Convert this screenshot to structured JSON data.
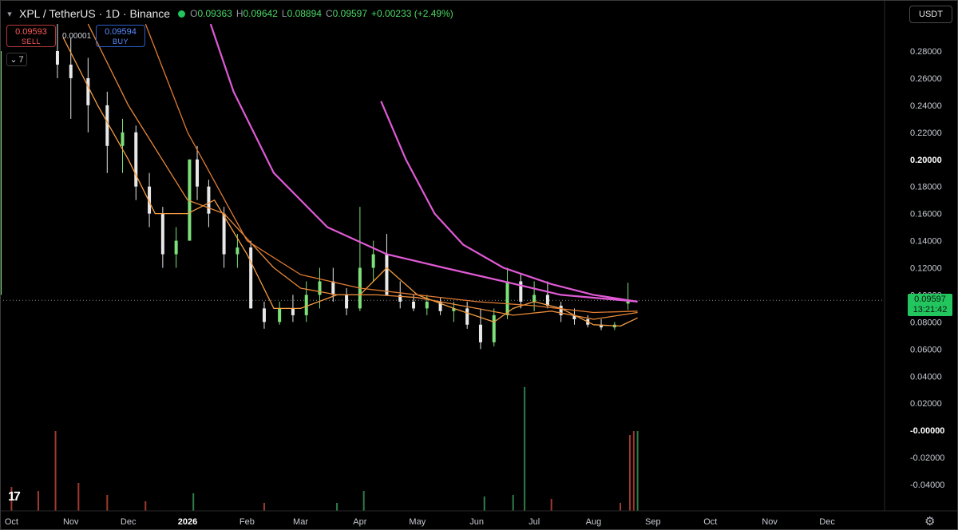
{
  "header": {
    "symbol": "XPL / TetherUS · 1D · Binance",
    "collapse_icon": "chevron-down-icon",
    "status_color": "#22c55e",
    "ohlc": {
      "o_label": "O",
      "o_value": "0.09363",
      "h_label": "H",
      "h_value": "0.09642",
      "l_label": "L",
      "l_value": "0.08894",
      "c_label": "C",
      "c_value": "0.09597",
      "change": "+0.00233 (+2.49%)"
    }
  },
  "trade": {
    "sell_price": "0.09593",
    "sell_label": "SELL",
    "spread": "0.00001",
    "buy_price": "0.09594",
    "buy_label": "BUY"
  },
  "indicators_toggle": {
    "icon": "chevron-down-icon",
    "count": "7"
  },
  "currency": "USDT",
  "last_price_tag": {
    "price": "0.09597",
    "countdown": "13:21:42",
    "color": "#22c55e"
  },
  "chart_data": {
    "type": "candlestick",
    "x_range": [
      "2025-09-25",
      "2026-12-31"
    ],
    "y_range": [
      -0.05,
      0.29
    ],
    "x_ticks": [
      {
        "label": "Oct",
        "date": "2025-10-01"
      },
      {
        "label": "Nov",
        "date": "2025-11-01"
      },
      {
        "label": "Dec",
        "date": "2025-12-01"
      },
      {
        "label": "2026",
        "date": "2026-01-01",
        "bold": true
      },
      {
        "label": "Feb",
        "date": "2026-02-01"
      },
      {
        "label": "Mar",
        "date": "2026-03-01"
      },
      {
        "label": "Apr",
        "date": "2026-04-01"
      },
      {
        "label": "May",
        "date": "2026-05-01"
      },
      {
        "label": "Jun",
        "date": "2026-06-01"
      },
      {
        "label": "Jul",
        "date": "2026-07-01"
      },
      {
        "label": "Aug",
        "date": "2026-08-01"
      },
      {
        "label": "Sep",
        "date": "2026-09-01"
      },
      {
        "label": "Oct",
        "date": "2026-10-01"
      },
      {
        "label": "Nov",
        "date": "2026-11-01"
      },
      {
        "label": "Dec",
        "date": "2026-12-01"
      }
    ],
    "y_ticks": [
      {
        "label": "0.28000",
        "value": 0.28
      },
      {
        "label": "0.26000",
        "value": 0.26
      },
      {
        "label": "0.24000",
        "value": 0.24
      },
      {
        "label": "0.22000",
        "value": 0.22
      },
      {
        "label": "0.20000",
        "value": 0.2,
        "bold": true
      },
      {
        "label": "0.18000",
        "value": 0.18
      },
      {
        "label": "0.16000",
        "value": 0.16
      },
      {
        "label": "0.14000",
        "value": 0.14
      },
      {
        "label": "0.12000",
        "value": 0.12
      },
      {
        "label": "0.10000",
        "value": 0.1
      },
      {
        "label": "0.08000",
        "value": 0.08
      },
      {
        "label": "0.06000",
        "value": 0.06
      },
      {
        "label": "0.04000",
        "value": 0.04
      },
      {
        "label": "0.02000",
        "value": 0.02
      },
      {
        "label": "-0.00000",
        "value": 0.0,
        "bold": true
      },
      {
        "label": "-0.02000",
        "value": -0.02
      },
      {
        "label": "-0.04000",
        "value": -0.04
      }
    ],
    "last_close": 0.09597,
    "series": [
      {
        "type": "candles",
        "color_up": "#7ee07a",
        "color_down": "#e8e8e8",
        "points": [
          [
            "2025-09-25",
            0.1,
            0.3,
            0.08,
            0.28
          ],
          [
            "2025-10-25",
            0.28,
            0.3,
            0.26,
            0.27
          ],
          [
            "2025-11-01",
            0.27,
            0.29,
            0.23,
            0.26
          ],
          [
            "2025-11-10",
            0.26,
            0.275,
            0.22,
            0.24
          ],
          [
            "2025-11-20",
            0.24,
            0.25,
            0.19,
            0.21
          ],
          [
            "2025-11-28",
            0.21,
            0.23,
            0.19,
            0.22
          ],
          [
            "2025-12-05",
            0.22,
            0.225,
            0.17,
            0.18
          ],
          [
            "2025-12-12",
            0.18,
            0.19,
            0.15,
            0.16
          ],
          [
            "2025-12-19",
            0.16,
            0.165,
            0.12,
            0.13
          ],
          [
            "2025-12-26",
            0.13,
            0.15,
            0.12,
            0.14
          ],
          [
            "2026-01-02",
            0.14,
            0.2,
            0.14,
            0.2
          ],
          [
            "2026-01-06",
            0.2,
            0.21,
            0.17,
            0.18
          ],
          [
            "2026-01-12",
            0.18,
            0.185,
            0.15,
            0.16
          ],
          [
            "2026-01-20",
            0.16,
            0.165,
            0.12,
            0.13
          ],
          [
            "2026-01-27",
            0.13,
            0.145,
            0.12,
            0.135
          ],
          [
            "2026-02-03",
            0.135,
            0.14,
            0.09,
            0.09
          ],
          [
            "2026-02-10",
            0.09,
            0.095,
            0.075,
            0.08
          ],
          [
            "2026-02-18",
            0.08,
            0.095,
            0.078,
            0.09
          ],
          [
            "2026-02-25",
            0.09,
            0.1,
            0.08,
            0.085
          ],
          [
            "2026-03-04",
            0.085,
            0.11,
            0.08,
            0.1
          ],
          [
            "2026-03-11",
            0.1,
            0.12,
            0.09,
            0.11
          ],
          [
            "2026-03-18",
            0.11,
            0.12,
            0.095,
            0.1
          ],
          [
            "2026-03-25",
            0.1,
            0.105,
            0.085,
            0.09
          ],
          [
            "2026-04-01",
            0.09,
            0.165,
            0.088,
            0.12
          ],
          [
            "2026-04-08",
            0.12,
            0.14,
            0.11,
            0.13
          ],
          [
            "2026-04-15",
            0.13,
            0.145,
            0.1,
            0.1
          ],
          [
            "2026-04-22",
            0.1,
            0.11,
            0.09,
            0.095
          ],
          [
            "2026-04-29",
            0.095,
            0.1,
            0.088,
            0.09
          ],
          [
            "2026-05-06",
            0.09,
            0.1,
            0.085,
            0.095
          ],
          [
            "2026-05-13",
            0.095,
            0.098,
            0.085,
            0.088
          ],
          [
            "2026-05-20",
            0.088,
            0.095,
            0.08,
            0.09
          ],
          [
            "2026-05-27",
            0.09,
            0.095,
            0.075,
            0.078
          ],
          [
            "2026-06-03",
            0.078,
            0.09,
            0.06,
            0.065
          ],
          [
            "2026-06-10",
            0.065,
            0.09,
            0.062,
            0.085
          ],
          [
            "2026-06-17",
            0.085,
            0.12,
            0.082,
            0.11
          ],
          [
            "2026-06-24",
            0.11,
            0.115,
            0.09,
            0.095
          ],
          [
            "2026-07-01",
            0.095,
            0.11,
            0.088,
            0.1
          ],
          [
            "2026-07-08",
            0.1,
            0.11,
            0.09,
            0.092
          ],
          [
            "2026-07-15",
            0.092,
            0.095,
            0.08,
            0.085
          ],
          [
            "2026-07-22",
            0.085,
            0.09,
            0.078,
            0.082
          ],
          [
            "2026-07-29",
            0.082,
            0.085,
            0.076,
            0.078
          ],
          [
            "2026-08-05",
            0.078,
            0.082,
            0.074,
            0.076
          ],
          [
            "2026-08-12",
            0.076,
            0.08,
            0.074,
            0.078
          ],
          [
            "2026-08-19",
            0.0936,
            0.109,
            0.0889,
            0.096
          ]
        ]
      },
      {
        "type": "line",
        "color": "#f59e42",
        "points": [
          [
            "2025-10-28",
            0.29
          ],
          [
            "2025-11-15",
            0.24
          ],
          [
            "2025-12-01",
            0.2
          ],
          [
            "2025-12-15",
            0.16
          ],
          [
            "2026-01-01",
            0.16
          ],
          [
            "2026-01-15",
            0.17
          ],
          [
            "2026-02-01",
            0.13
          ],
          [
            "2026-02-15",
            0.09
          ],
          [
            "2026-03-01",
            0.09
          ],
          [
            "2026-03-20",
            0.1
          ],
          [
            "2026-04-01",
            0.1
          ],
          [
            "2026-04-15",
            0.12
          ],
          [
            "2026-05-01",
            0.1
          ],
          [
            "2026-05-20",
            0.09
          ],
          [
            "2026-06-10",
            0.08
          ],
          [
            "2026-06-20",
            0.09
          ],
          [
            "2026-07-01",
            0.095
          ],
          [
            "2026-07-15",
            0.09
          ],
          [
            "2026-08-01",
            0.078
          ],
          [
            "2026-08-15",
            0.077
          ],
          [
            "2026-08-24",
            0.083
          ]
        ]
      },
      {
        "type": "line",
        "color": "#e8893a",
        "points": [
          [
            "2025-11-10",
            0.3
          ],
          [
            "2025-12-01",
            0.24
          ],
          [
            "2026-01-01",
            0.17
          ],
          [
            "2026-01-20",
            0.16
          ],
          [
            "2026-02-15",
            0.12
          ],
          [
            "2026-03-01",
            0.105
          ],
          [
            "2026-03-20",
            0.1
          ],
          [
            "2026-04-10",
            0.1
          ],
          [
            "2026-05-01",
            0.098
          ],
          [
            "2026-06-01",
            0.09
          ],
          [
            "2026-06-20",
            0.085
          ],
          [
            "2026-07-10",
            0.088
          ],
          [
            "2026-08-01",
            0.082
          ],
          [
            "2026-08-24",
            0.087
          ]
        ]
      },
      {
        "type": "line",
        "color": "#e07b32",
        "points": [
          [
            "2025-12-10",
            0.3
          ],
          [
            "2026-01-01",
            0.22
          ],
          [
            "2026-02-01",
            0.14
          ],
          [
            "2026-03-01",
            0.115
          ],
          [
            "2026-04-01",
            0.105
          ],
          [
            "2026-05-01",
            0.1
          ],
          [
            "2026-06-01",
            0.095
          ],
          [
            "2026-07-01",
            0.092
          ],
          [
            "2026-08-01",
            0.087
          ],
          [
            "2026-08-24",
            0.088
          ]
        ]
      },
      {
        "type": "line",
        "color": "#e05ad6",
        "points": [
          [
            "2026-01-13",
            0.3
          ],
          [
            "2026-01-25",
            0.25
          ],
          [
            "2026-02-15",
            0.19
          ],
          [
            "2026-03-15",
            0.15
          ],
          [
            "2026-04-15",
            0.13
          ],
          [
            "2026-05-15",
            0.12
          ],
          [
            "2026-06-15",
            0.11
          ],
          [
            "2026-07-15",
            0.1
          ],
          [
            "2026-08-24",
            0.095
          ]
        ]
      },
      {
        "type": "line",
        "color": "#e05ad6",
        "points": [
          [
            "2026-04-12",
            0.243
          ],
          [
            "2026-04-25",
            0.2
          ],
          [
            "2026-05-10",
            0.16
          ],
          [
            "2026-05-25",
            0.137
          ],
          [
            "2026-06-15",
            0.12
          ],
          [
            "2026-07-10",
            0.108
          ],
          [
            "2026-08-01",
            0.1
          ],
          [
            "2026-08-24",
            0.095
          ]
        ]
      }
    ],
    "volume": {
      "color_up": "#2e7d4a",
      "color_down": "#a0392f",
      "bars": [
        [
          "2025-10-01",
          0.3,
          "down"
        ],
        [
          "2025-10-15",
          0.25,
          "down"
        ],
        [
          "2025-10-24",
          1.0,
          "down"
        ],
        [
          "2025-11-05",
          0.35,
          "down"
        ],
        [
          "2025-11-20",
          0.2,
          "down"
        ],
        [
          "2025-12-10",
          0.12,
          "down"
        ],
        [
          "2026-01-04",
          0.22,
          "up"
        ],
        [
          "2026-02-10",
          0.1,
          "down"
        ],
        [
          "2026-03-20",
          0.1,
          "up"
        ],
        [
          "2026-04-03",
          0.25,
          "up"
        ],
        [
          "2026-06-05",
          0.18,
          "up"
        ],
        [
          "2026-06-20",
          0.2,
          "up"
        ],
        [
          "2026-06-26",
          1.55,
          "up"
        ],
        [
          "2026-07-10",
          0.15,
          "down"
        ],
        [
          "2026-08-15",
          0.1,
          "down"
        ],
        [
          "2026-08-20",
          0.95,
          "down"
        ],
        [
          "2026-08-22",
          1.0,
          "down"
        ],
        [
          "2026-08-24",
          1.0,
          "up"
        ]
      ]
    }
  }
}
